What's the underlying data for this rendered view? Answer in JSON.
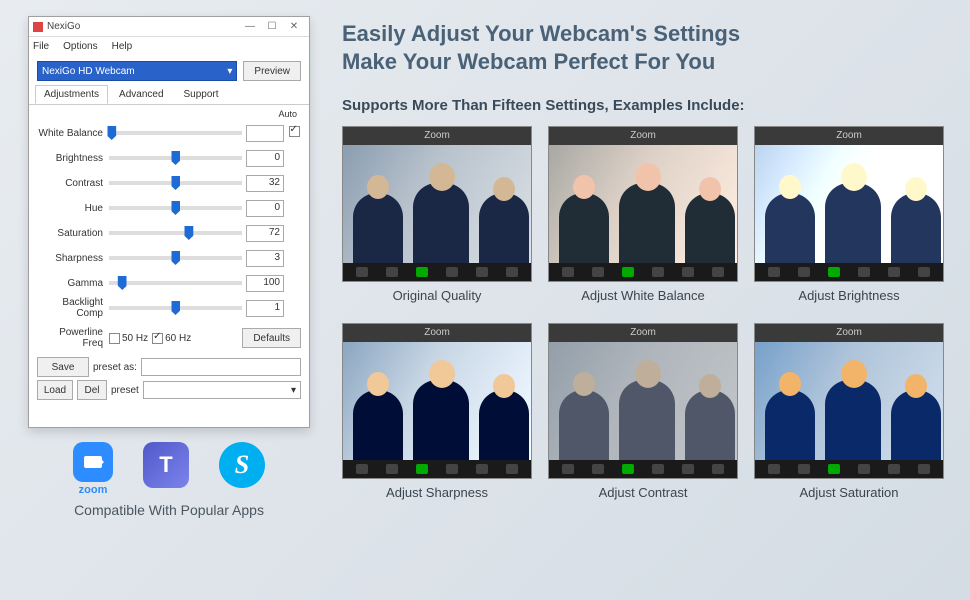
{
  "window": {
    "title": "NexiGo",
    "menu": [
      "File",
      "Options",
      "Help"
    ],
    "device": "NexiGo HD Webcam",
    "preview_btn": "Preview",
    "tabs": [
      "Adjustments",
      "Advanced",
      "Support"
    ],
    "auto_label": "Auto",
    "sliders": [
      {
        "label": "White Balance",
        "pos": 2,
        "value": "",
        "auto": true
      },
      {
        "label": "Brightness",
        "pos": 50,
        "value": "0",
        "auto": false
      },
      {
        "label": "Contrast",
        "pos": 50,
        "value": "32",
        "auto": false
      },
      {
        "label": "Hue",
        "pos": 50,
        "value": "0",
        "auto": false
      },
      {
        "label": "Saturation",
        "pos": 60,
        "value": "72",
        "auto": false
      },
      {
        "label": "Sharpness",
        "pos": 50,
        "value": "3",
        "auto": false
      },
      {
        "label": "Gamma",
        "pos": 10,
        "value": "100",
        "auto": false
      },
      {
        "label": "Backlight Comp",
        "pos": 50,
        "value": "1",
        "auto": false
      }
    ],
    "powerline": {
      "label": "Powerline Freq",
      "opt1": "50 Hz",
      "opt2": "60 Hz",
      "sel": 2
    },
    "defaults_btn": "Defaults",
    "save_btn": "Save",
    "load_btn": "Load",
    "del_btn": "Del",
    "preset_as_label": "preset as:",
    "preset_label": "preset"
  },
  "compat": {
    "zoom_text": "zoom",
    "caption": "Compatible With Popular Apps"
  },
  "marketing": {
    "headline1": "Easily Adjust Your Webcam's Settings",
    "headline2": "Make Your Webcam Perfect For You",
    "subhead": "Supports More Than Fifteen Settings, Examples Include:",
    "thumb_app": "Zoom",
    "cards": [
      {
        "caption": "Original Quality",
        "cls": ""
      },
      {
        "caption": "Adjust White Balance",
        "cls": "wb"
      },
      {
        "caption": "Adjust Brightness",
        "cls": "br"
      },
      {
        "caption": "Adjust Sharpness",
        "cls": "sh"
      },
      {
        "caption": "Adjust Contrast",
        "cls": "ct"
      },
      {
        "caption": "Adjust Saturation",
        "cls": "sa"
      }
    ]
  }
}
